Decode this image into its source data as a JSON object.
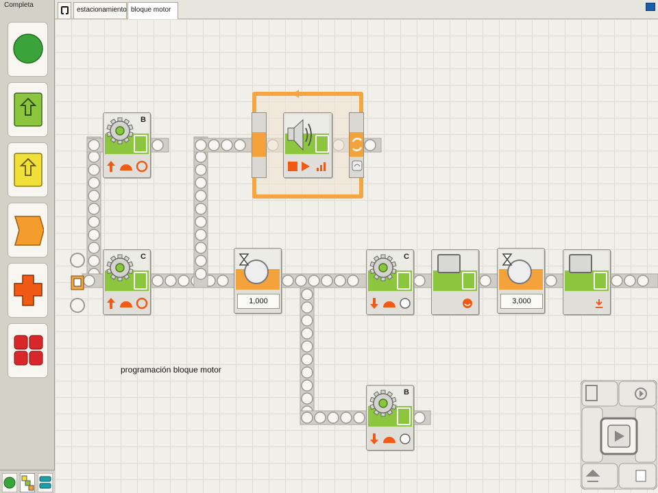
{
  "palette": {
    "header": "Completa",
    "buttons": [
      {
        "name": "start-circle",
        "color": "#3aa33a"
      },
      {
        "name": "action-block",
        "color": "#8cc63e"
      },
      {
        "name": "sensor-block",
        "color": "#f2e03a"
      },
      {
        "name": "flow-block",
        "color": "#f59c2e"
      },
      {
        "name": "data-block",
        "color": "#f05a14"
      },
      {
        "name": "advanced-block",
        "color": "#d8282a"
      }
    ],
    "bottom_tabs": [
      "common-palette-tab",
      "complete-palette-tab",
      "custom-palette-tab"
    ]
  },
  "tabs": [
    {
      "label": "estacionamiento"
    },
    {
      "label": "bloque motor"
    }
  ],
  "blocks": {
    "motor_b_top": {
      "port": "B"
    },
    "motor_c_main": {
      "port": "C"
    },
    "wait_1": {
      "value": "1,000"
    },
    "motor_c_second": {
      "port": "C"
    },
    "wait_2": {
      "value": "3,000"
    },
    "motor_b_bottom": {
      "port": "B"
    }
  },
  "comment": "programación bloque motor",
  "colors": {
    "action_green": "#8cc63e",
    "flow_orange": "#f4a33c",
    "loop_orange": "#f5a640",
    "beam_gray": "#cfcdc6"
  }
}
